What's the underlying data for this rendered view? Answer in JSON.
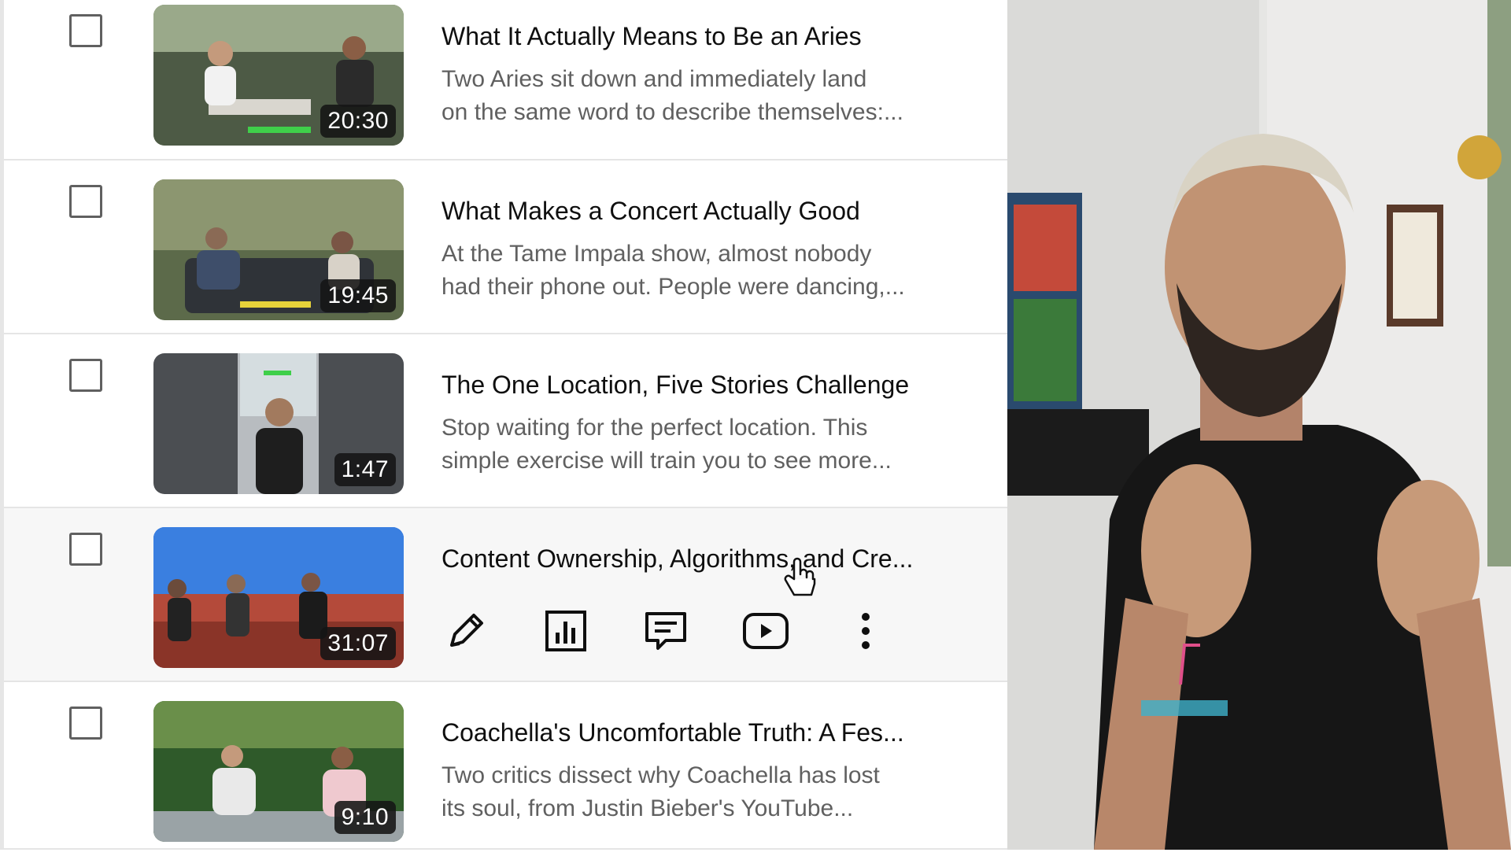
{
  "videos": [
    {
      "title": "What It Actually Means to Be an Aries",
      "description_line1": "Two Aries sit down and immediately land",
      "description_line2": "on the same word to describe themselves:...",
      "duration": "20:30"
    },
    {
      "title": "What Makes a Concert Actually Good",
      "description_line1": "At the Tame Impala show, almost nobody",
      "description_line2": "had their phone out. People were dancing,...",
      "duration": "19:45"
    },
    {
      "title": "The One Location, Five Stories Challenge",
      "description_line1": "Stop waiting for the perfect location. This",
      "description_line2": "simple exercise will train you to see more...",
      "duration": "1:47"
    },
    {
      "title": "Content Ownership, Algorithms, and Cre...",
      "duration": "31:07"
    },
    {
      "title": "Coachella's Uncomfortable Truth: A Fes...",
      "description_line1": "Two critics dissect why Coachella has lost",
      "description_line2": "its soul, from Justin Bieber's YouTube...",
      "duration": "9:10"
    }
  ],
  "row_actions": {
    "icons": [
      "pencil-icon",
      "analytics-icon",
      "comments-icon",
      "youtube-play-icon",
      "more-vert-icon"
    ]
  },
  "colors": {
    "title": "#0f0f0f",
    "description": "#606060",
    "divider": "#e5e5e5",
    "hover_row": "#f7f7f7"
  }
}
